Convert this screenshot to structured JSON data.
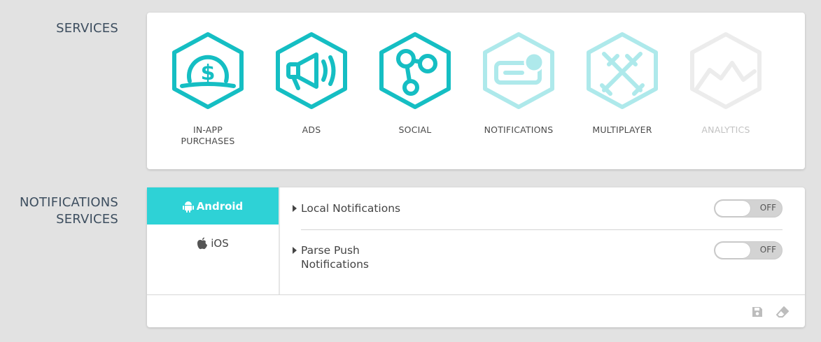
{
  "sections": {
    "services_title": "SERVICES",
    "notifications_title_line1": "NOTIFICATIONS",
    "notifications_title_line2": "SERVICES"
  },
  "services": [
    {
      "label_line1": "IN-APP",
      "label_line2": "PURCHASES",
      "icon": "coin-in-hand-icon",
      "state": "active"
    },
    {
      "label_line1": "ADS",
      "label_line2": "",
      "icon": "megaphone-icon",
      "state": "active"
    },
    {
      "label_line1": "SOCIAL",
      "label_line2": "",
      "icon": "share-nodes-icon",
      "state": "active"
    },
    {
      "label_line1": "NOTIFICATIONS",
      "label_line2": "",
      "icon": "notification-badge-icon",
      "state": "selected"
    },
    {
      "label_line1": "MULTIPLAYER",
      "label_line2": "",
      "icon": "crossed-swords-icon",
      "state": "selected"
    },
    {
      "label_line1": "ANALYTICS",
      "label_line2": "",
      "icon": "line-chart-icon",
      "state": "disabled"
    }
  ],
  "colors": {
    "accent": "#15bec3",
    "accent_light": "#aee9eb",
    "disabled": "#ececec",
    "tab_active": "#2ed2d6",
    "heading": "#3d4e5f"
  },
  "platforms": {
    "android_label": "Android",
    "ios_label": "iOS",
    "selected": "Android"
  },
  "settings": {
    "local": {
      "label": "Local Notifications",
      "toggle": "OFF"
    },
    "parse": {
      "label_line1": "Parse Push",
      "label_line2": "Notifications",
      "toggle": "OFF"
    }
  },
  "footer": {
    "save_icon": "save-icon",
    "clear_icon": "eraser-icon"
  }
}
